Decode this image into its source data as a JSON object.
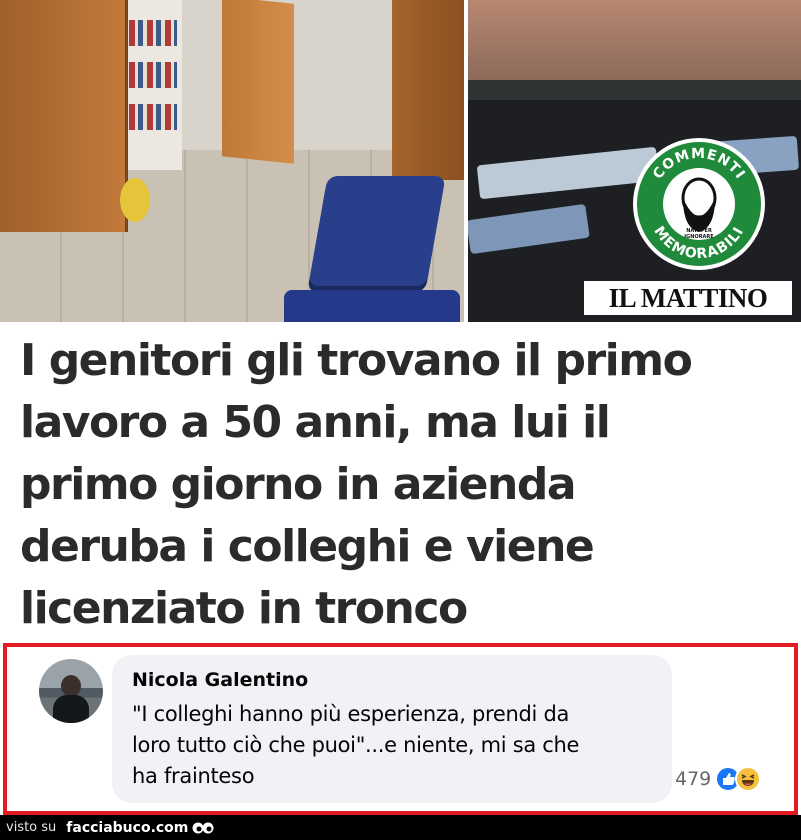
{
  "source_tag": "IL MATTINO",
  "logo": {
    "top_text": "COMMENTI",
    "bottom_text": "MEMORABILI",
    "inner_text_1": "NATI PER",
    "inner_text_2": "IGNORARE",
    "color": "#1f8a3a"
  },
  "headline": {
    "lines": [
      "I genitori gli trovano il primo",
      "lavoro a 50 anni, ma lui il",
      "primo giorno in azienda",
      "deruba i colleghi e viene",
      "licenziato in tronco"
    ]
  },
  "comment": {
    "author": "Nicola Galentino",
    "lines": [
      "\"I colleghi hanno più esperienza, prendi da",
      "loro tutto ciò che puoi\"...e niente, mi sa che",
      "ha frainteso"
    ],
    "reaction_count": "479",
    "reaction_icons": [
      "like-icon",
      "haha-icon"
    ],
    "border_color": "#e01b22"
  },
  "footer": {
    "seen_on": "visto su",
    "site": "facciabuco.com"
  }
}
